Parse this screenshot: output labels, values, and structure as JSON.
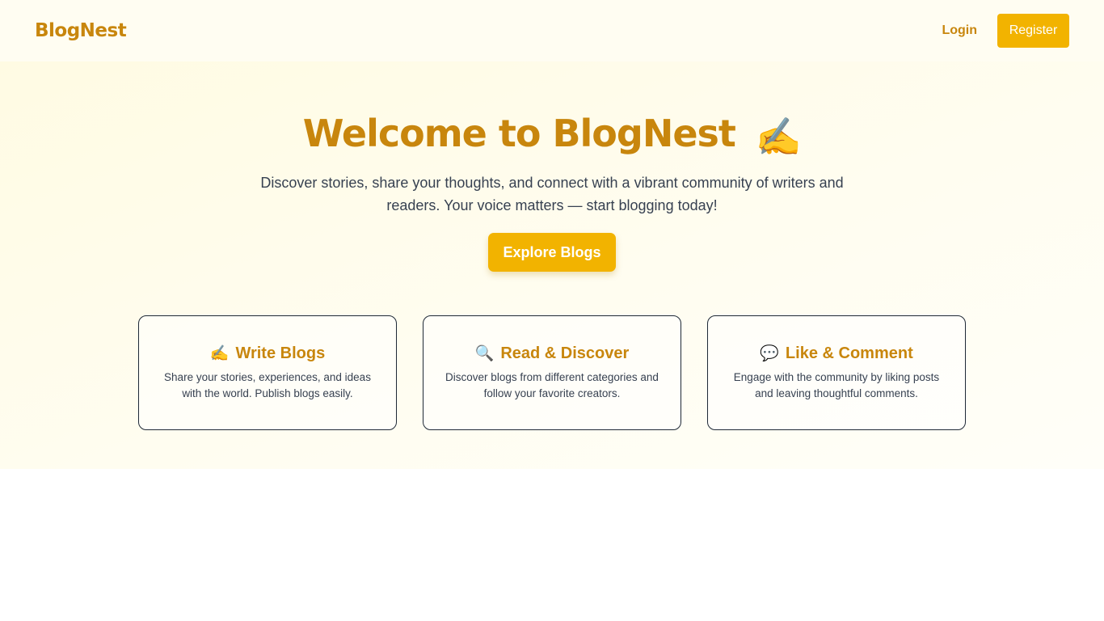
{
  "navbar": {
    "brand": "BlogNest",
    "login_label": "Login",
    "register_label": "Register"
  },
  "hero": {
    "title": "Welcome to BlogNest",
    "title_emoji": "✍️",
    "subtitle": "Discover stories, share your thoughts, and connect with a vibrant community of writers and readers. Your voice matters — start blogging today!",
    "cta_label": "Explore Blogs"
  },
  "features": [
    {
      "icon": "writing-hand-icon",
      "emoji": "✍️",
      "title": "Write Blogs",
      "description": "Share your stories, experiences, and ideas with the world. Publish blogs easily."
    },
    {
      "icon": "magnifier-icon",
      "emoji": "🔍",
      "title": "Read & Discover",
      "description": "Discover blogs from different categories and follow your favorite creators."
    },
    {
      "icon": "speech-bubble-icon",
      "emoji": "💬",
      "title": "Like & Comment",
      "description": "Engage with the community by liking posts and leaving thoughtful comments."
    }
  ],
  "colors": {
    "brand": "#c8860d",
    "accent": "#f2b300",
    "text": "#374151",
    "hero_background": "#fffbe3"
  }
}
